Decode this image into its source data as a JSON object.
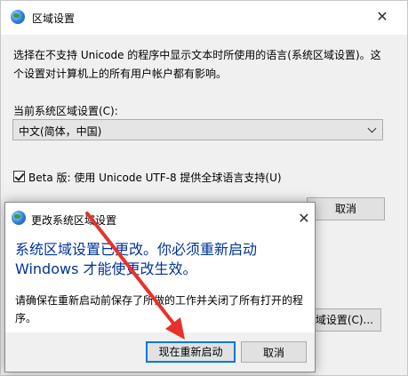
{
  "region_window": {
    "title": "区域设置",
    "close_glyph": "✕",
    "description": "选择在不支持 Unicode 的程序中显示文本时所使用的语言(系统区域设置)。这\n个设置对计算机上的所有用户帐户都有影响。",
    "current_locale_label": "当前系统区域设置(C):",
    "locale_value": "中文(简体，中国)",
    "utf8_checkbox_label": "Beta 版: 使用 Unicode UTF-8 提供全球语言支持(U)",
    "utf8_checked": true,
    "cancel_label": "取消",
    "partial_button_label": "域设置(C)..."
  },
  "change_dialog": {
    "title": "更改系统区域设置",
    "close_glyph": "✕",
    "headline": "系统区域设置已更改。你必须重新启动\nWindows 才能使更改生效。",
    "body": "请确保在重新启动前保存了所做的工作并关闭了所有打开的程\n序。",
    "restart_label": "现在重新启动",
    "cancel_label": "取消"
  },
  "icons": {
    "window_icon": "globe-icon",
    "dialog_icon": "globe-icon",
    "dropdown": "chevron-down-icon"
  },
  "colors": {
    "accent": "#0078d7",
    "headline": "#003399",
    "annotation_arrow": "#e8312a"
  }
}
